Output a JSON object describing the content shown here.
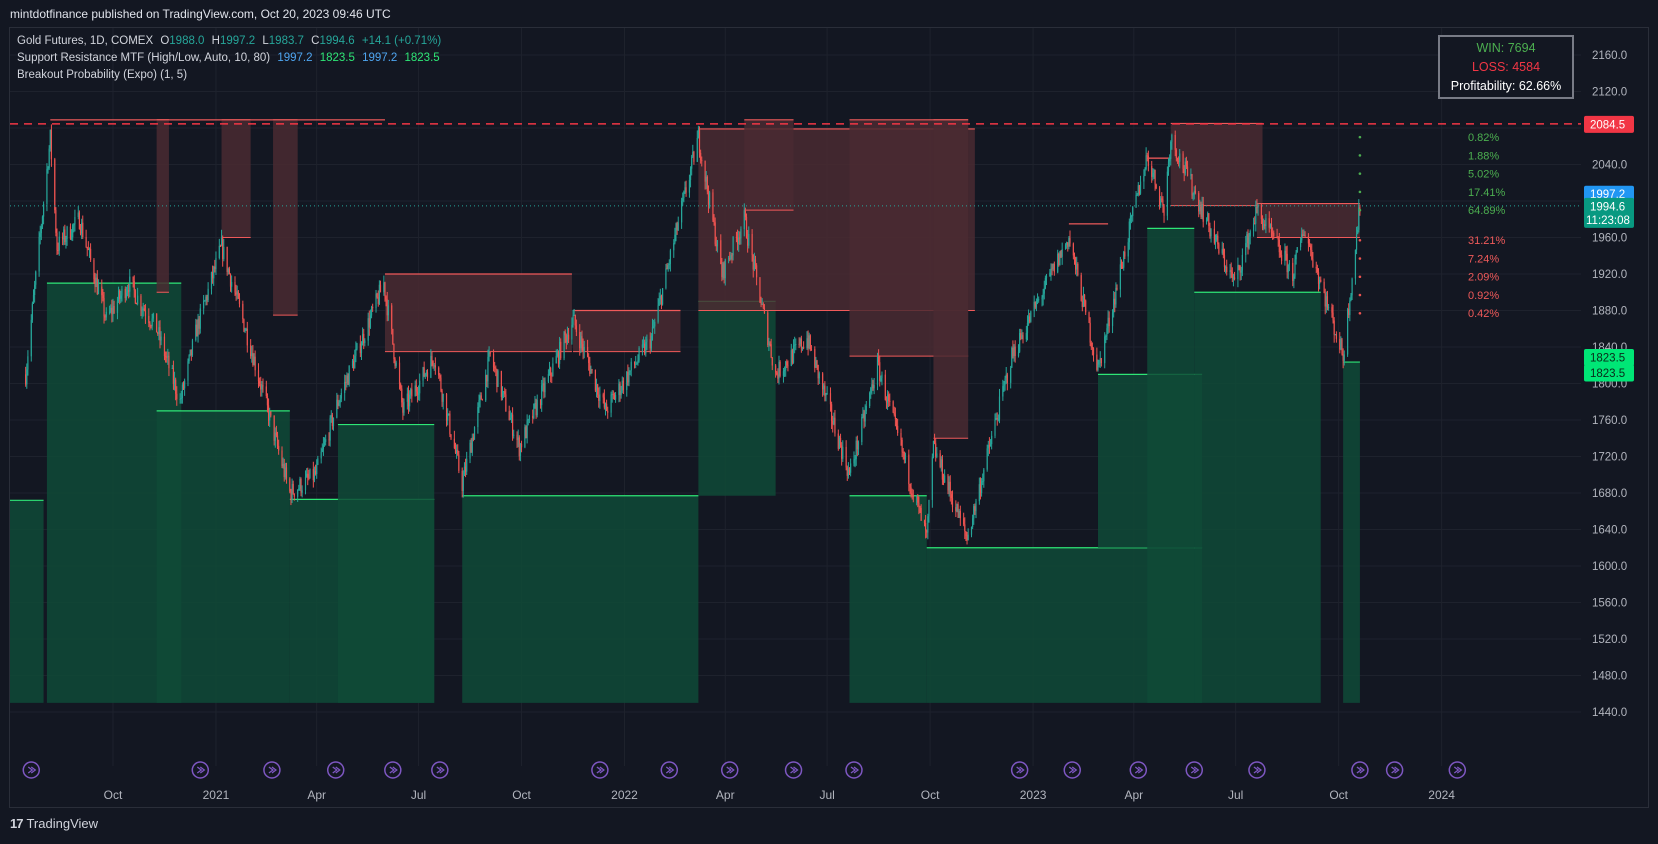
{
  "header": "mintdotfinance published on TradingView.com, Oct 20, 2023 09:46 UTC",
  "legend": {
    "row1": {
      "name": "Gold Futures, 1D, COMEX",
      "o_k": "O",
      "o": "1988.0",
      "h_k": "H",
      "h": "1997.2",
      "l_k": "L",
      "l": "1983.7",
      "c_k": "C",
      "c": "1994.6",
      "chg": "+14.1 (+0.71%)"
    },
    "row2": {
      "name": "Support Resistance MTF (High/Low, Auto, 10, 80)",
      "v1": "1997.2",
      "v2": "1823.5",
      "v3": "1997.2",
      "v4": "1823.5"
    },
    "row3": {
      "name": "Breakout Probability (Expo) (1, 5)"
    }
  },
  "stats": {
    "win": "WIN: 7694",
    "loss": "LOSS: 4584",
    "profitability": "Profitability: 62.66%"
  },
  "footer": {
    "brand": "TradingView"
  },
  "colors": {
    "bg": "#131722",
    "up": "#26a69a",
    "down": "#ef5350",
    "res_fill": "#4a2a31",
    "res_line": "#f05a5a",
    "sup_fill": "#0f4a37",
    "sup_line": "#2ee676",
    "grid": "#1e222d",
    "dash": "#f23645",
    "blue": "#2196f3",
    "green_label": "#00e676",
    "teal_label": "#089981"
  },
  "chart_data": {
    "type": "candlestick",
    "title": "Gold Futures, 1D, COMEX",
    "ylim": [
      1420,
      2180
    ],
    "y_ticks": [
      2160,
      2120,
      2080,
      2040,
      2000,
      1960,
      1920,
      1880,
      1840,
      1800,
      1760,
      1720,
      1680,
      1640,
      1600,
      1560,
      1520,
      1480,
      1440
    ],
    "y_tick_labels": [
      "2160.0",
      "2120.0",
      "2080.0",
      "2040.0",
      "2000.0",
      "1960.0",
      "1920.0",
      "1880.0",
      "1840.0",
      "1800.0",
      "1760.0",
      "1720.0",
      "1680.0",
      "1640.0",
      "1600.0",
      "1560.0",
      "1520.0",
      "1480.0",
      "1440.0"
    ],
    "x_ticks": [
      {
        "label": "Oct",
        "date": "2020-10-01"
      },
      {
        "label": "2021",
        "date": "2021-01-01"
      },
      {
        "label": "Apr",
        "date": "2021-04-01"
      },
      {
        "label": "Jul",
        "date": "2021-07-01"
      },
      {
        "label": "Oct",
        "date": "2021-10-01"
      },
      {
        "label": "2022",
        "date": "2022-01-01"
      },
      {
        "label": "Apr",
        "date": "2022-04-01"
      },
      {
        "label": "Jul",
        "date": "2022-07-01"
      },
      {
        "label": "Oct",
        "date": "2022-10-01"
      },
      {
        "label": "2023",
        "date": "2023-01-01"
      },
      {
        "label": "Apr",
        "date": "2023-04-01"
      },
      {
        "label": "Jul",
        "date": "2023-07-01"
      },
      {
        "label": "Oct",
        "date": "2023-10-01"
      },
      {
        "label": "2024",
        "date": "2024-01-01"
      }
    ],
    "close_path": [
      [
        "2020-07-15",
        1810
      ],
      [
        "2020-08-06",
        2069
      ],
      [
        "2020-08-12",
        1950
      ],
      [
        "2020-09-01",
        1980
      ],
      [
        "2020-09-25",
        1870
      ],
      [
        "2020-10-15",
        1910
      ],
      [
        "2020-11-09",
        1860
      ],
      [
        "2020-11-30",
        1780
      ],
      [
        "2020-12-15",
        1860
      ],
      [
        "2021-01-06",
        1950
      ],
      [
        "2021-02-01",
        1840
      ],
      [
        "2021-03-08",
        1680
      ],
      [
        "2021-03-31",
        1700
      ],
      [
        "2021-04-20",
        1780
      ],
      [
        "2021-05-31",
        1910
      ],
      [
        "2021-06-17",
        1770
      ],
      [
        "2021-07-15",
        1830
      ],
      [
        "2021-08-09",
        1690
      ],
      [
        "2021-09-03",
        1830
      ],
      [
        "2021-09-29",
        1730
      ],
      [
        "2021-11-16",
        1870
      ],
      [
        "2021-12-15",
        1770
      ],
      [
        "2022-01-25",
        1850
      ],
      [
        "2022-03-08",
        2070
      ],
      [
        "2022-03-29",
        1920
      ],
      [
        "2022-04-18",
        1980
      ],
      [
        "2022-05-16",
        1810
      ],
      [
        "2022-06-13",
        1850
      ],
      [
        "2022-07-21",
        1700
      ],
      [
        "2022-08-15",
        1820
      ],
      [
        "2022-09-28",
        1630
      ],
      [
        "2022-10-04",
        1730
      ],
      [
        "2022-11-03",
        1630
      ],
      [
        "2022-12-13",
        1830
      ],
      [
        "2023-02-02",
        1960
      ],
      [
        "2023-02-28",
        1815
      ],
      [
        "2023-04-03",
        2000
      ],
      [
        "2023-04-13",
        2050
      ],
      [
        "2023-04-28",
        1990
      ],
      [
        "2023-05-04",
        2070
      ],
      [
        "2023-06-15",
        1950
      ],
      [
        "2023-06-30",
        1910
      ],
      [
        "2023-07-20",
        1990
      ],
      [
        "2023-08-21",
        1920
      ],
      [
        "2023-08-31",
        1970
      ],
      [
        "2023-10-05",
        1830
      ],
      [
        "2023-10-20",
        1994.6
      ]
    ],
    "resistance_zones": [
      {
        "from": "2020-08-06",
        "to": "2021-06-01",
        "top": 2089
      },
      {
        "from": "2020-11-09",
        "to": "2020-11-20",
        "bottom": 1900
      },
      {
        "from": "2021-01-06",
        "to": "2021-02-01",
        "bottom": 1960
      },
      {
        "from": "2021-02-21",
        "to": "2021-03-15",
        "bottom": 1875
      },
      {
        "from": "2021-06-01",
        "to": "2021-11-15",
        "top": 1920,
        "bottom": 1835
      },
      {
        "from": "2021-11-16",
        "to": "2022-02-20",
        "top": 1880,
        "bottom": 1835
      },
      {
        "from": "2022-03-08",
        "to": "2022-11-10",
        "top": 2079,
        "bottom": 1880
      },
      {
        "from": "2022-04-18",
        "to": "2022-06-01",
        "bottom": 1990
      },
      {
        "from": "2022-07-21",
        "to": "2022-11-04",
        "bottom": 1830
      },
      {
        "from": "2022-10-04",
        "to": "2022-11-04",
        "bottom": 1740
      },
      {
        "from": "2023-02-02",
        "to": "2023-03-09",
        "top": 1975
      },
      {
        "from": "2023-04-13",
        "to": "2023-05-04",
        "top": 2047
      },
      {
        "from": "2023-05-04",
        "to": "2023-07-25",
        "top": 2085,
        "bottom": 1995
      },
      {
        "from": "2023-07-20",
        "to": "2023-10-20",
        "top": 1997.2,
        "bottom": 1960
      }
    ],
    "support_zones": [
      {
        "from": "2020-07-01",
        "to": "2020-07-31",
        "top": 1672
      },
      {
        "from": "2020-08-03",
        "to": "2020-12-01",
        "top": 1910,
        "bottom": 1450
      },
      {
        "from": "2020-11-09",
        "to": "2021-03-08",
        "top": 1770
      },
      {
        "from": "2021-03-08",
        "to": "2021-07-15",
        "top": 1673
      },
      {
        "from": "2021-04-20",
        "to": "2021-07-15",
        "top": 1755
      },
      {
        "from": "2021-08-09",
        "to": "2022-03-08",
        "top": 1677
      },
      {
        "from": "2022-03-08",
        "to": "2022-05-16",
        "top": 1890,
        "bottom": 1677
      },
      {
        "from": "2022-07-21",
        "to": "2022-09-28",
        "top": 1677
      },
      {
        "from": "2022-09-28",
        "to": "2023-06-01",
        "top": 1620
      },
      {
        "from": "2023-02-28",
        "to": "2023-06-01",
        "top": 1810,
        "bottom": 1620
      },
      {
        "from": "2023-04-13",
        "to": "2023-05-25",
        "top": 1970
      },
      {
        "from": "2023-05-25",
        "to": "2023-09-15",
        "top": 1900
      },
      {
        "from": "2023-10-05",
        "to": "2023-10-20",
        "top": 1823.5
      }
    ],
    "dashed_level": 2084.5,
    "breakout_levels": [
      {
        "price": 2070,
        "label": "0.82%",
        "dir": "up"
      },
      {
        "price": 2050,
        "label": "1.88%",
        "dir": "up"
      },
      {
        "price": 2030,
        "label": "5.02%",
        "dir": "up"
      },
      {
        "price": 2010,
        "label": "17.41%",
        "dir": "up"
      },
      {
        "price": 1990,
        "label": "64.89%",
        "dir": "up"
      },
      {
        "price": 1957,
        "label": "31.21%",
        "dir": "down"
      },
      {
        "price": 1937,
        "label": "7.24%",
        "dir": "down"
      },
      {
        "price": 1917,
        "label": "2.09%",
        "dir": "down"
      },
      {
        "price": 1897,
        "label": "0.92%",
        "dir": "down"
      },
      {
        "price": 1877,
        "label": "0.42%",
        "dir": "down"
      }
    ],
    "price_labels": [
      {
        "price": 2084.5,
        "text": "2084.5",
        "color": "#f23645"
      },
      {
        "price": 2008,
        "text": "1997.2",
        "color": "#2196f3"
      },
      {
        "price": 1992,
        "text": "1997.2",
        "color": "#2196f3"
      },
      {
        "price": 1994.6,
        "text": "1994.6",
        "sub": "11:23:08",
        "color": "#089981"
      },
      {
        "price": 1829,
        "text": "1823.5",
        "color": "#00e676"
      },
      {
        "price": 1812,
        "text": "1823.5",
        "color": "#00e676"
      }
    ],
    "event_markers": [
      "2020-07-20",
      "2020-12-18",
      "2021-02-20",
      "2021-04-18",
      "2021-06-08",
      "2021-07-20",
      "2021-12-10",
      "2022-02-10",
      "2022-04-05",
      "2022-06-01",
      "2022-07-25",
      "2022-12-20",
      "2023-02-05",
      "2023-04-05",
      "2023-05-25",
      "2023-07-20",
      "2023-10-20",
      "2023-11-20",
      "2024-01-15"
    ]
  }
}
